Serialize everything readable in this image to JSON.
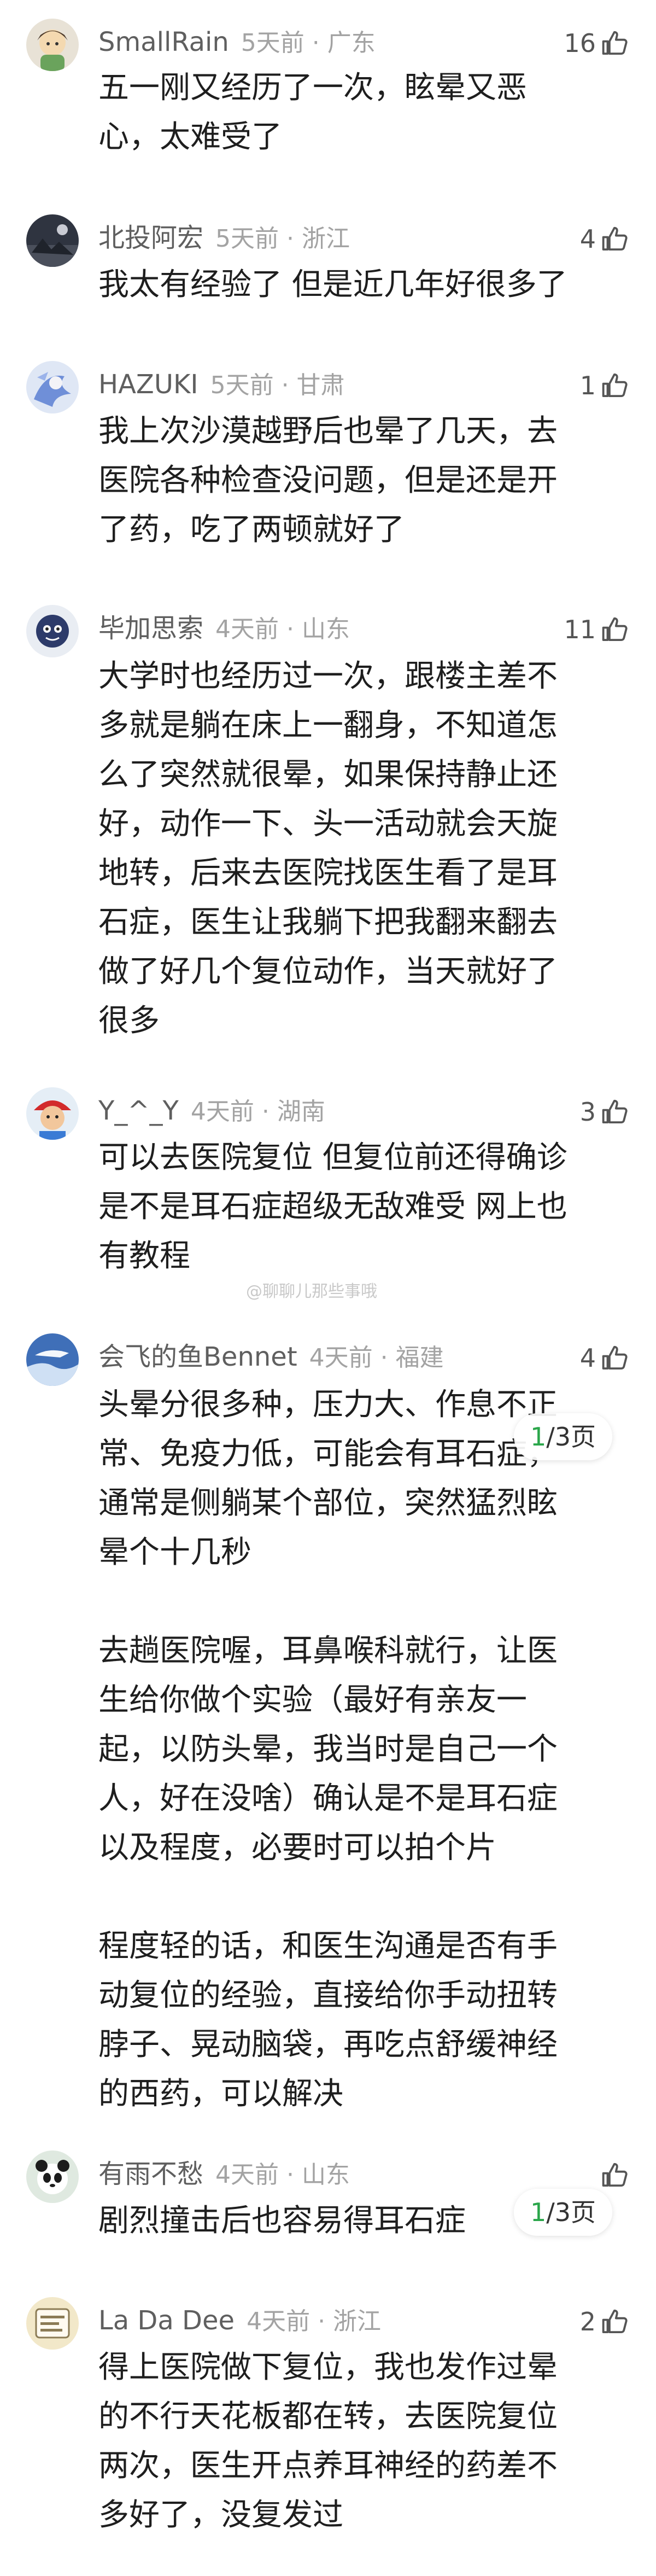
{
  "comments": [
    {
      "username": "SmallRain",
      "time": "5天前",
      "location": "广东",
      "likes": "16",
      "text": "五一刚又经历了一次，眩晕又恶\n心，太难受了"
    },
    {
      "username": "北投阿宏",
      "time": "5天前",
      "location": "浙江",
      "likes": "4",
      "text": "我太有经验了 但是近几年好很多了"
    },
    {
      "username": "HAZUKI",
      "time": "5天前",
      "location": "甘肃",
      "likes": "1",
      "text": "我上次沙漠越野后也晕了几天，去\n医院各种检查没问题，但是还是开\n了药，吃了两顿就好了"
    },
    {
      "username": "毕加思索",
      "time": "4天前",
      "location": "山东",
      "likes": "11",
      "text": "大学时也经历过一次，跟楼主差不\n多就是躺在床上一翻身，不知道怎\n么了突然就很晕，如果保持静止还\n好，动作一下、头一活动就会天旋\n地转，后来去医院找医生看了是耳\n石症，医生让我躺下把我翻来翻去\n做了好几个复位动作，当天就好了\n很多"
    },
    {
      "username": "Y_^_Y",
      "time": "4天前",
      "location": "湖南",
      "likes": "3",
      "text": "可以去医院复位 但复位前还得确诊\n是不是耳石症超级无敌难受 网上也\n有教程"
    },
    {
      "username": "会飞的鱼Bennet",
      "time": "4天前",
      "location": "福建",
      "likes": "4",
      "text": "头晕分很多种，压力大、作息不正\n常、免疫力低，可能会有耳石症，\n通常是侧躺某个部位，突然猛烈眩\n晕个十几秒\n\n去趟医院喔，耳鼻喉科就行，让医\n生给你做个实验（最好有亲友一\n起，以防头晕，我当时是自己一个\n人，好在没啥）确认是不是耳石症\n以及程度，必要时可以拍个片\n\n程度轻的话，和医生沟通是否有手\n动复位的经验，直接给你手动扭转\n脖子、晃动脑袋，再吃点舒缓神经\n的西药，可以解决"
    },
    {
      "username": "有雨不愁",
      "time": "4天前",
      "location": "山东",
      "likes": "",
      "text": "剧烈撞击后也容易得耳石症"
    },
    {
      "username": "La Da Dee",
      "time": "4天前",
      "location": "浙江",
      "likes": "2",
      "text": "得上医院做下复位，我也发作过晕\n的不行天花板都在转，去医院复位\n两次，医生开点养耳神经的药差不\n多好了，没复发过"
    }
  ],
  "pager": {
    "current": "1",
    "sep_total": "/3页"
  },
  "watermark": "@聊聊儿那些事哦"
}
